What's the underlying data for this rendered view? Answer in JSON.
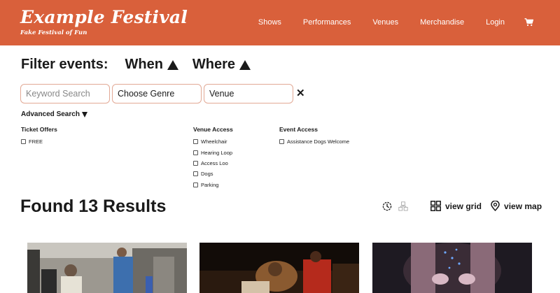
{
  "header": {
    "title": "Example Festival",
    "tagline": "Fake Festival of Fun",
    "nav": [
      "Shows",
      "Performances",
      "Venues",
      "Merchandise",
      "Login"
    ],
    "cart_icon": "cart-icon",
    "bg_color": "#d9603b"
  },
  "filters": {
    "heading": "Filter events:",
    "when": "When",
    "where": "Where",
    "keyword_placeholder": "Keyword Search",
    "genre_value": "Choose Genre",
    "venue_value": "Venue",
    "clear": "✕",
    "advanced": "Advanced Search"
  },
  "facets": {
    "ticket_offers": {
      "title": "Ticket Offers",
      "options": [
        "FREE"
      ]
    },
    "venue_access": {
      "title": "Venue Access",
      "options": [
        "Wheelchair",
        "Hearing Loop",
        "Access Loo",
        "Dogs",
        "Parking"
      ]
    },
    "event_access": {
      "title": "Event Access",
      "options": [
        "Assistance Dogs Welcome"
      ]
    }
  },
  "results": {
    "heading": "Found 13 Results",
    "view_grid": "view grid",
    "view_map": "view map"
  }
}
